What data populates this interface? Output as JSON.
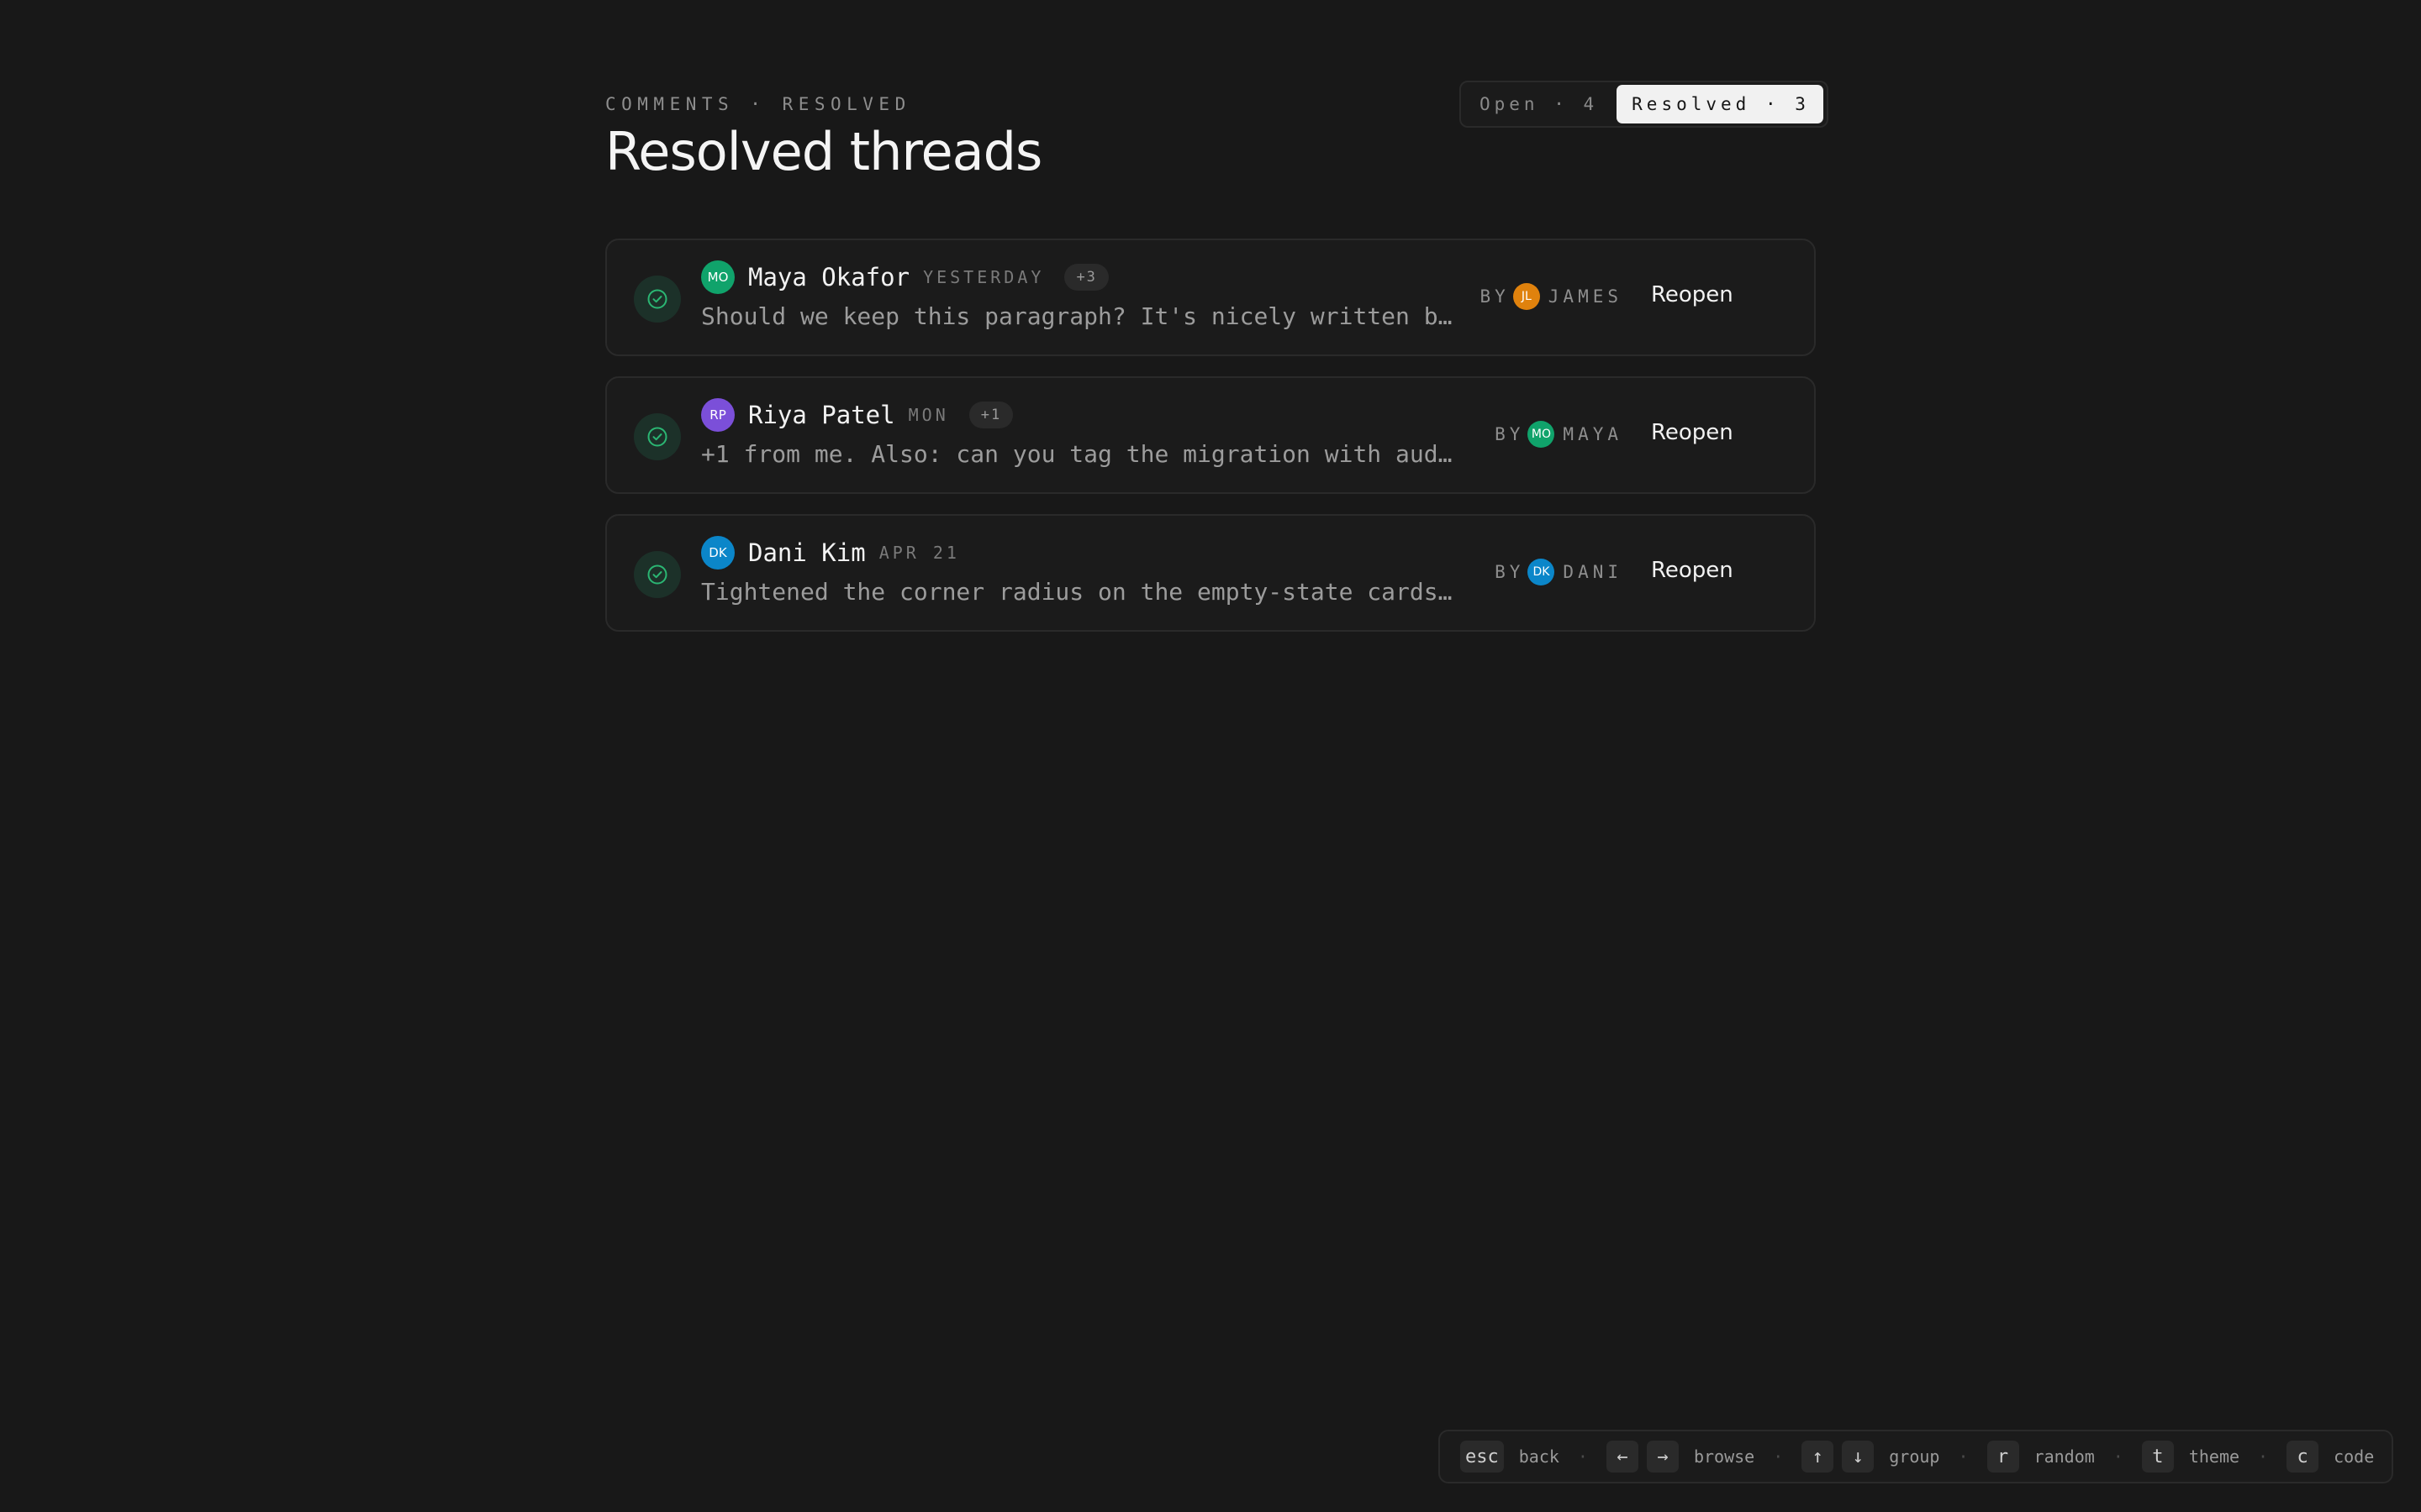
{
  "header": {
    "eyebrow": "COMMENTS · RESOLVED",
    "title": "Resolved threads"
  },
  "filter": {
    "open_label": "Open · 4",
    "resolved_label": "Resolved · 3",
    "selected": "Resolved · 3"
  },
  "threads": [
    {
      "author_initials": "MO",
      "author_name": "Maya Okafor",
      "author_color": "#10a36b",
      "when": "YESTERDAY",
      "replies": "+3",
      "snippet": "Should we keep this paragraph? It's nicely written but",
      "by_label": "BY",
      "resolver_initials": "JL",
      "resolver_name": "JAMES",
      "resolver_color": "#e0820d",
      "action": "Reopen"
    },
    {
      "author_initials": "RP",
      "author_name": "Riya Patel",
      "author_color": "#7b4fd9",
      "when": "MON",
      "replies": "+1",
      "snippet": "+1 from me. Also: can you tag the migration with audit",
      "by_label": "BY",
      "resolver_initials": "MO",
      "resolver_name": "MAYA",
      "resolver_color": "#10a36b",
      "action": "Reopen"
    },
    {
      "author_initials": "DK",
      "author_name": "Dani Kim",
      "author_color": "#0b86c9",
      "when": "APR 21",
      "replies": "",
      "snippet": "Tightened the corner radius on the empty-state cards to",
      "by_label": "BY",
      "resolver_initials": "DK",
      "resolver_name": "DANI",
      "resolver_color": "#0b86c9",
      "action": "Reopen"
    }
  ],
  "shortcuts": [
    {
      "keys": [
        "esc"
      ],
      "label": "back"
    },
    {
      "keys": [
        "←",
        "→"
      ],
      "label": "browse"
    },
    {
      "keys": [
        "↑",
        "↓"
      ],
      "label": "group"
    },
    {
      "keys": [
        "r"
      ],
      "label": "random"
    },
    {
      "keys": [
        "t"
      ],
      "label": "theme"
    },
    {
      "keys": [
        "c"
      ],
      "label": "code"
    }
  ],
  "colors": {
    "background": "#181818",
    "resolved_check": "#2bb673"
  }
}
